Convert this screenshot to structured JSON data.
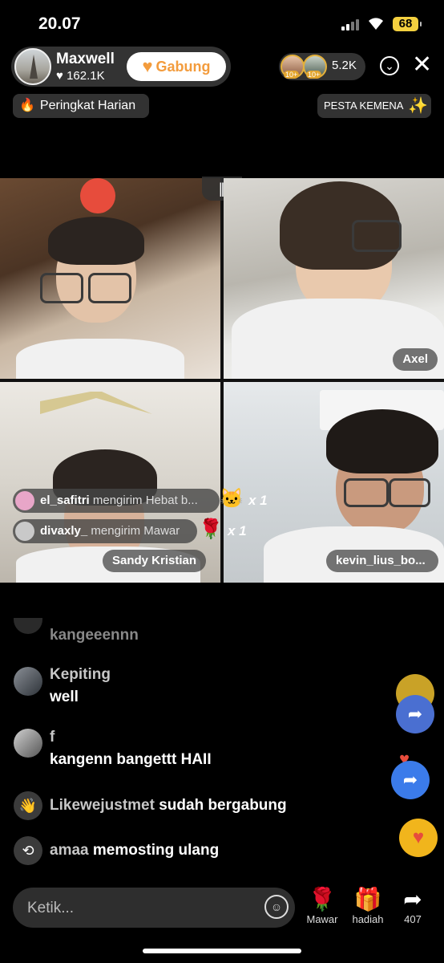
{
  "status_bar": {
    "time": "20.07",
    "battery": "68"
  },
  "host": {
    "name": "Maxwell",
    "likes": "162.1K",
    "join_label": "Gabung"
  },
  "viewers": {
    "count": "5.2K",
    "badge_1": "10+",
    "badge_2": "10+"
  },
  "ranking": {
    "label": "Peringkat Harian"
  },
  "event": {
    "label": "PESTA KEMENA"
  },
  "participants": [
    {
      "name": ""
    },
    {
      "name": "Axel"
    },
    {
      "name": "Sandy Kristian"
    },
    {
      "name": "kevin_lius_bo..."
    }
  ],
  "gifts": [
    {
      "user": "el_safitri",
      "message": "mengirim Hebat b...",
      "count": "x 1"
    },
    {
      "user": "divaxly_",
      "message": "mengirim Mawar",
      "count": "x 1"
    }
  ],
  "chat": [
    {
      "text": "kangeeennn"
    },
    {
      "user": "Kepiting",
      "text": "well"
    },
    {
      "user": "f",
      "text": "kangenn bangettt HAII"
    },
    {
      "user": "Likewejustmet",
      "text": "sudah bergabung"
    },
    {
      "user": "amaa",
      "text": "memosting ulang"
    }
  ],
  "input": {
    "placeholder": "Ketik..."
  },
  "bottom_actions": {
    "rose_label": "Mawar",
    "gift_label": "hadiah",
    "share_count": "407"
  },
  "colors": {
    "join_accent": "#f39c3d",
    "battery": "#f4d03f",
    "share_blue": "#3b7bea"
  }
}
